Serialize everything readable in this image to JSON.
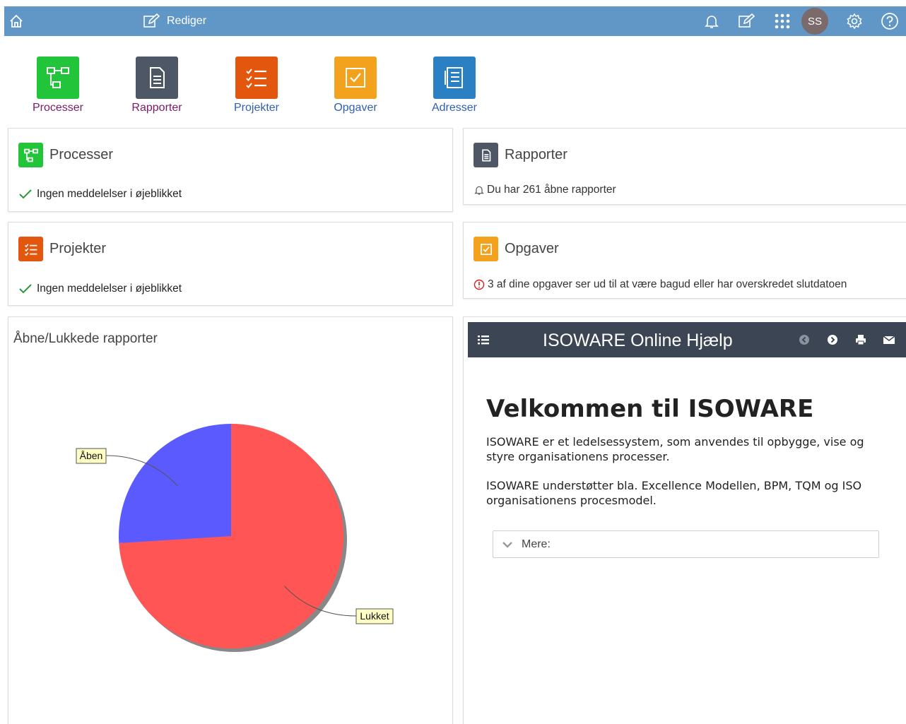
{
  "topbar": {
    "edit_label": "Rediger",
    "avatar_initials": "SS",
    "icons": [
      "home-icon",
      "edit-icon",
      "bell-icon",
      "edit-icon",
      "apps-grid-icon",
      "settings-icon",
      "help-icon"
    ],
    "color": "#6097c6"
  },
  "apps": [
    {
      "label": "Processer",
      "icon": "process-icon",
      "color": "#22c43a",
      "label_color": "#7a1a6a"
    },
    {
      "label": "Rapporter",
      "icon": "report-icon",
      "color": "#4d5766",
      "label_color": "#7a1a6a"
    },
    {
      "label": "Projekter",
      "icon": "checklist-icon",
      "color": "#e2560e",
      "label_color": "#2f5fb3"
    },
    {
      "label": "Opgaver",
      "icon": "task-icon",
      "color": "#f3a21e",
      "label_color": "#2f5fb3"
    },
    {
      "label": "Adresser",
      "icon": "address-book-icon",
      "color": "#2a80c2",
      "label_color": "#2f5fb3"
    }
  ],
  "cards": {
    "processer": {
      "title": "Processer",
      "message": "Ingen meddelelser i øjeblikket"
    },
    "rapporter": {
      "title": "Rapporter",
      "message": "Du har 261 åbne rapporter"
    },
    "projekter": {
      "title": "Projekter",
      "message": "Ingen meddelelser i øjeblikket"
    },
    "opgaver": {
      "title": "Opgaver",
      "message": "3 af dine opgaver ser ud til at være bagud eller har overskredet slutdatoen"
    }
  },
  "chart_data": {
    "type": "pie",
    "title": "Åbne/Lukkede rapporter",
    "series": [
      {
        "name": "Åben",
        "value": 26,
        "color": "#5a5aff"
      },
      {
        "name": "Lukket",
        "value": 74,
        "color": "#ff5555"
      }
    ]
  },
  "help": {
    "bar_title": "ISOWARE Online Hjælp",
    "heading": "Velkommen til ISOWARE",
    "paragraph1": "ISOWARE er et ledelsessystem, som anvendes til opbygge, vise og styre organisationens processer.",
    "paragraph2": "ISOWARE understøtter bla. Excellence Modellen, BPM,  TQM og ISO organisationens procesmodel.",
    "more_label": "Mere:"
  }
}
